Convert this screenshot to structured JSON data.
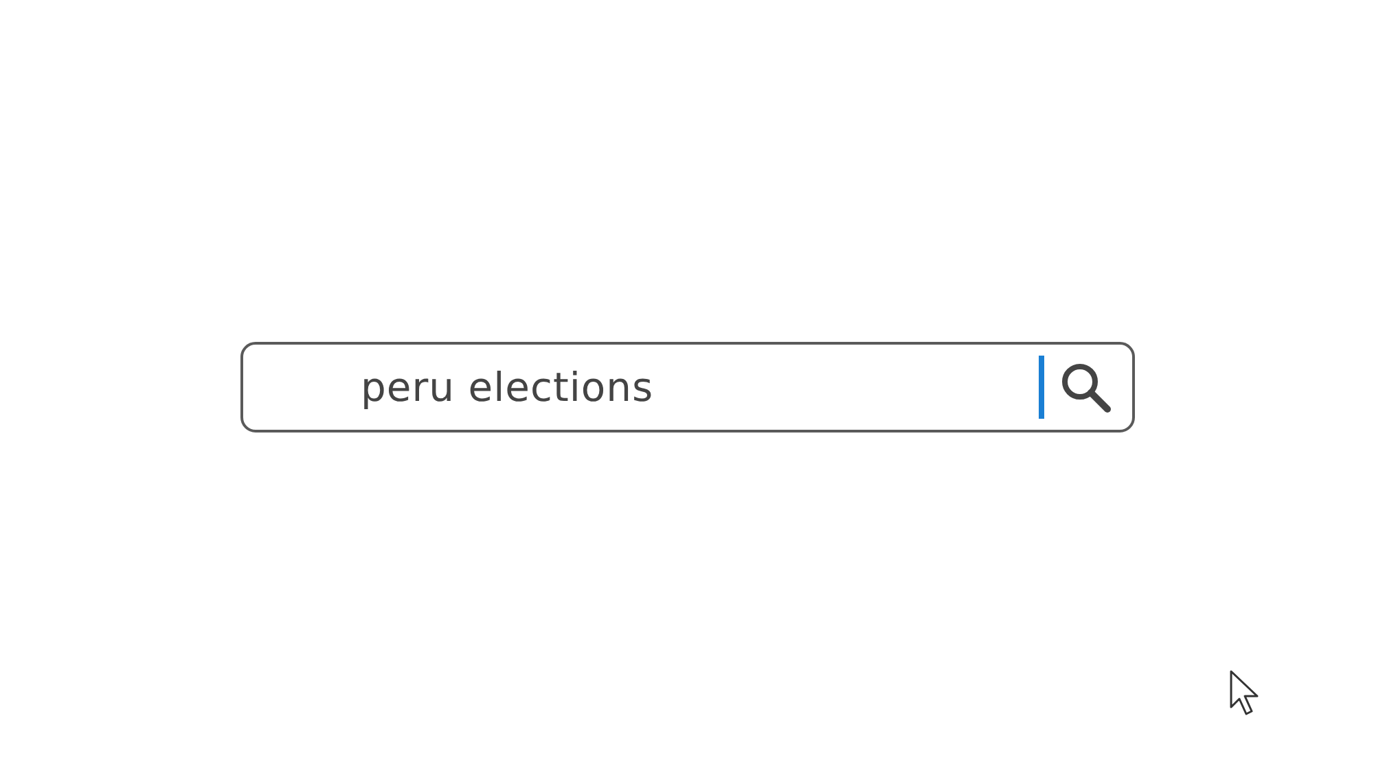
{
  "search": {
    "value": "peru elections"
  }
}
